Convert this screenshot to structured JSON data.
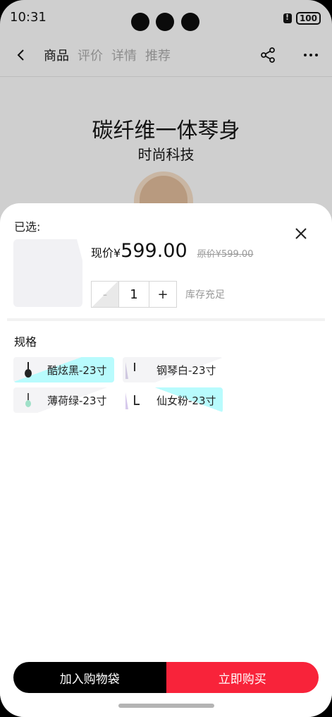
{
  "status_bar": {
    "time": "10:31",
    "battery": "100"
  },
  "nav": {
    "tabs": [
      "商品",
      "评价",
      "详情",
      "推荐"
    ],
    "active_tab": 0
  },
  "hero": {
    "title": "碳纤维一体琴身",
    "subtitle": "时尚科技"
  },
  "sheet": {
    "selected_label": "已选:",
    "price_label": "现价",
    "currency": "¥",
    "price": "599.00",
    "original_price": "原价¥599.00",
    "quantity": "1",
    "minus": "-",
    "plus": "+",
    "stock": "库存充足",
    "spec_title": "规格",
    "options": [
      {
        "label": "酷炫黑-23寸",
        "selected": true
      },
      {
        "label": "钢琴白-23寸",
        "selected": false
      },
      {
        "label": "薄荷绿-23寸",
        "selected": false
      },
      {
        "label": "仙女粉-23寸",
        "selected": false
      }
    ]
  },
  "actions": {
    "add_to_bag": "加入购物袋",
    "buy_now": "立即购买"
  },
  "colors": {
    "buy_red": "#f8233a",
    "cyan_accent": "#b8fbfd",
    "black": "#000000"
  }
}
